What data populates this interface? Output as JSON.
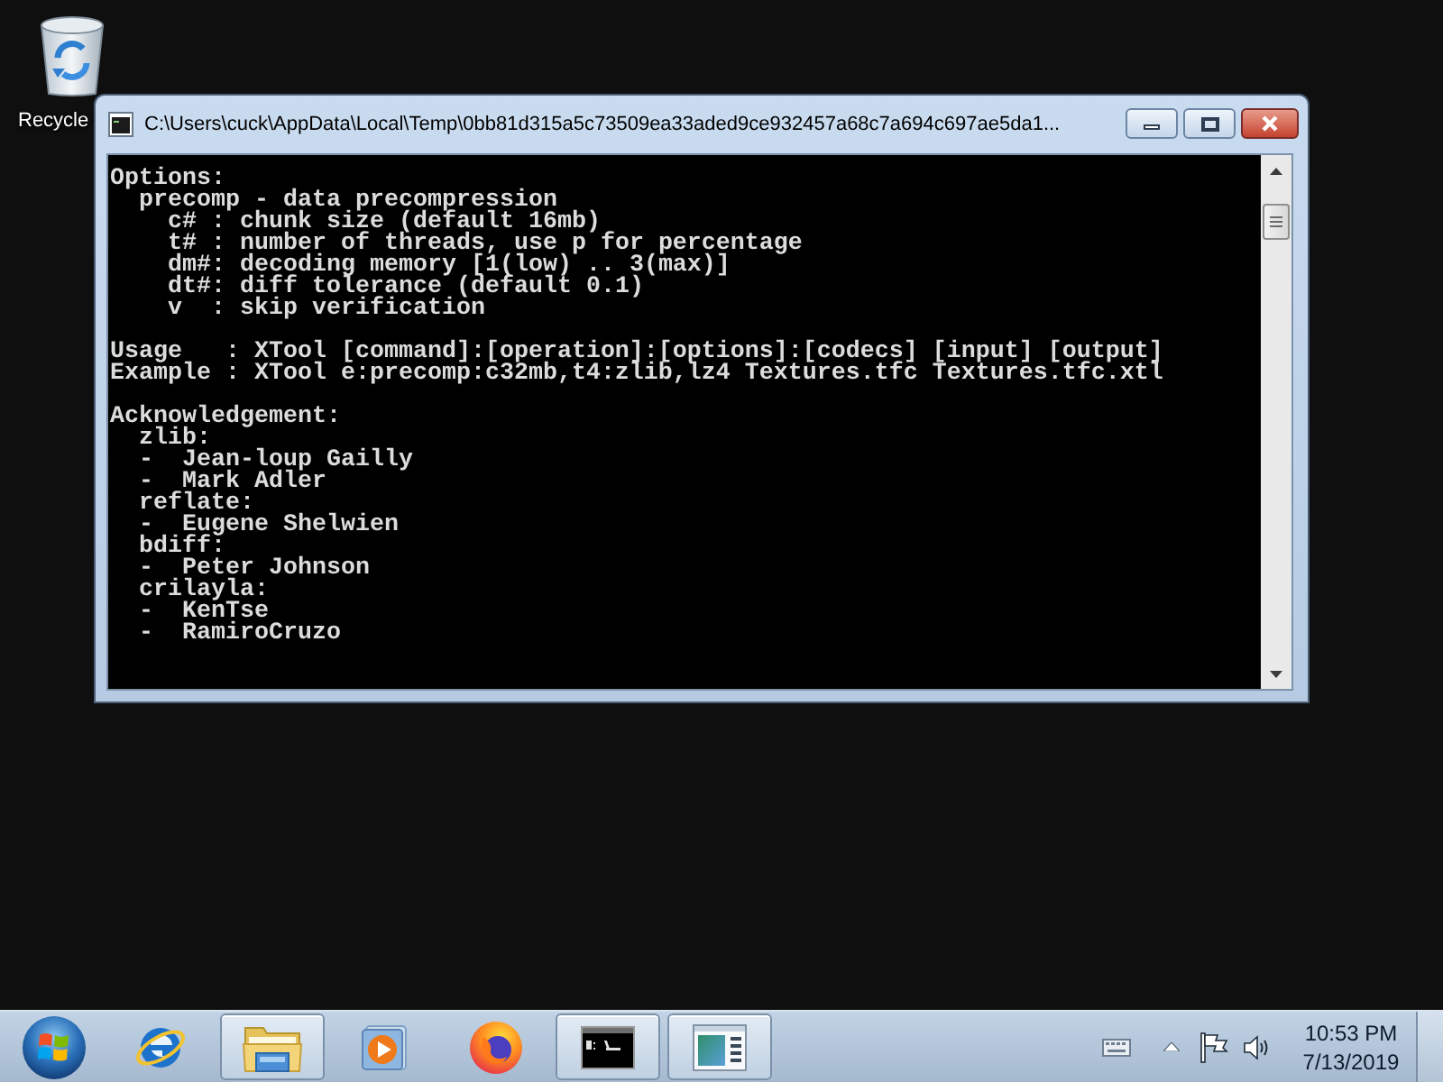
{
  "desktop": {
    "icons": [
      {
        "label": "Recycle"
      }
    ]
  },
  "window": {
    "title": "C:\\Users\\cuck\\AppData\\Local\\Temp\\0bb81d315a5c73509ea33aded9ce932457a68c7a694c697ae5da1...",
    "console": {
      "blocks": [
        [
          "Options:",
          "  precomp - data precompression",
          "    c# : chunk size (default 16mb)",
          "    t# : number of threads, use p for percentage",
          "    dm#: decoding memory [1(low) .. 3(max)]",
          "    dt#: diff tolerance (default 0.1)",
          "    v  : skip verification"
        ],
        [
          "Usage   : XTool [command]:[operation]:[options]:[codecs] [input] [output]",
          "Example : XTool e:precomp:c32mb,t4:zlib,lz4 Textures.tfc Textures.tfc.xtl"
        ],
        [
          "Acknowledgement:",
          "  zlib:",
          "  -  Jean-loup Gailly",
          "  -  Mark Adler",
          "  reflate:",
          "  -  Eugene Shelwien",
          "  bdiff:",
          "  -  Peter Johnson",
          "  crilayla:",
          "  -  KenTse",
          "  -  RamiroCruzo"
        ]
      ]
    }
  },
  "taskbar": {
    "items": [
      {
        "kind": "ie",
        "running": false
      },
      {
        "kind": "explorer",
        "running": true
      },
      {
        "kind": "player",
        "running": false
      },
      {
        "kind": "firefox",
        "running": false
      },
      {
        "kind": "console",
        "running": true
      },
      {
        "kind": "window",
        "running": true
      }
    ],
    "clock": {
      "time": "10:53 PM",
      "date": "7/13/2019"
    }
  }
}
